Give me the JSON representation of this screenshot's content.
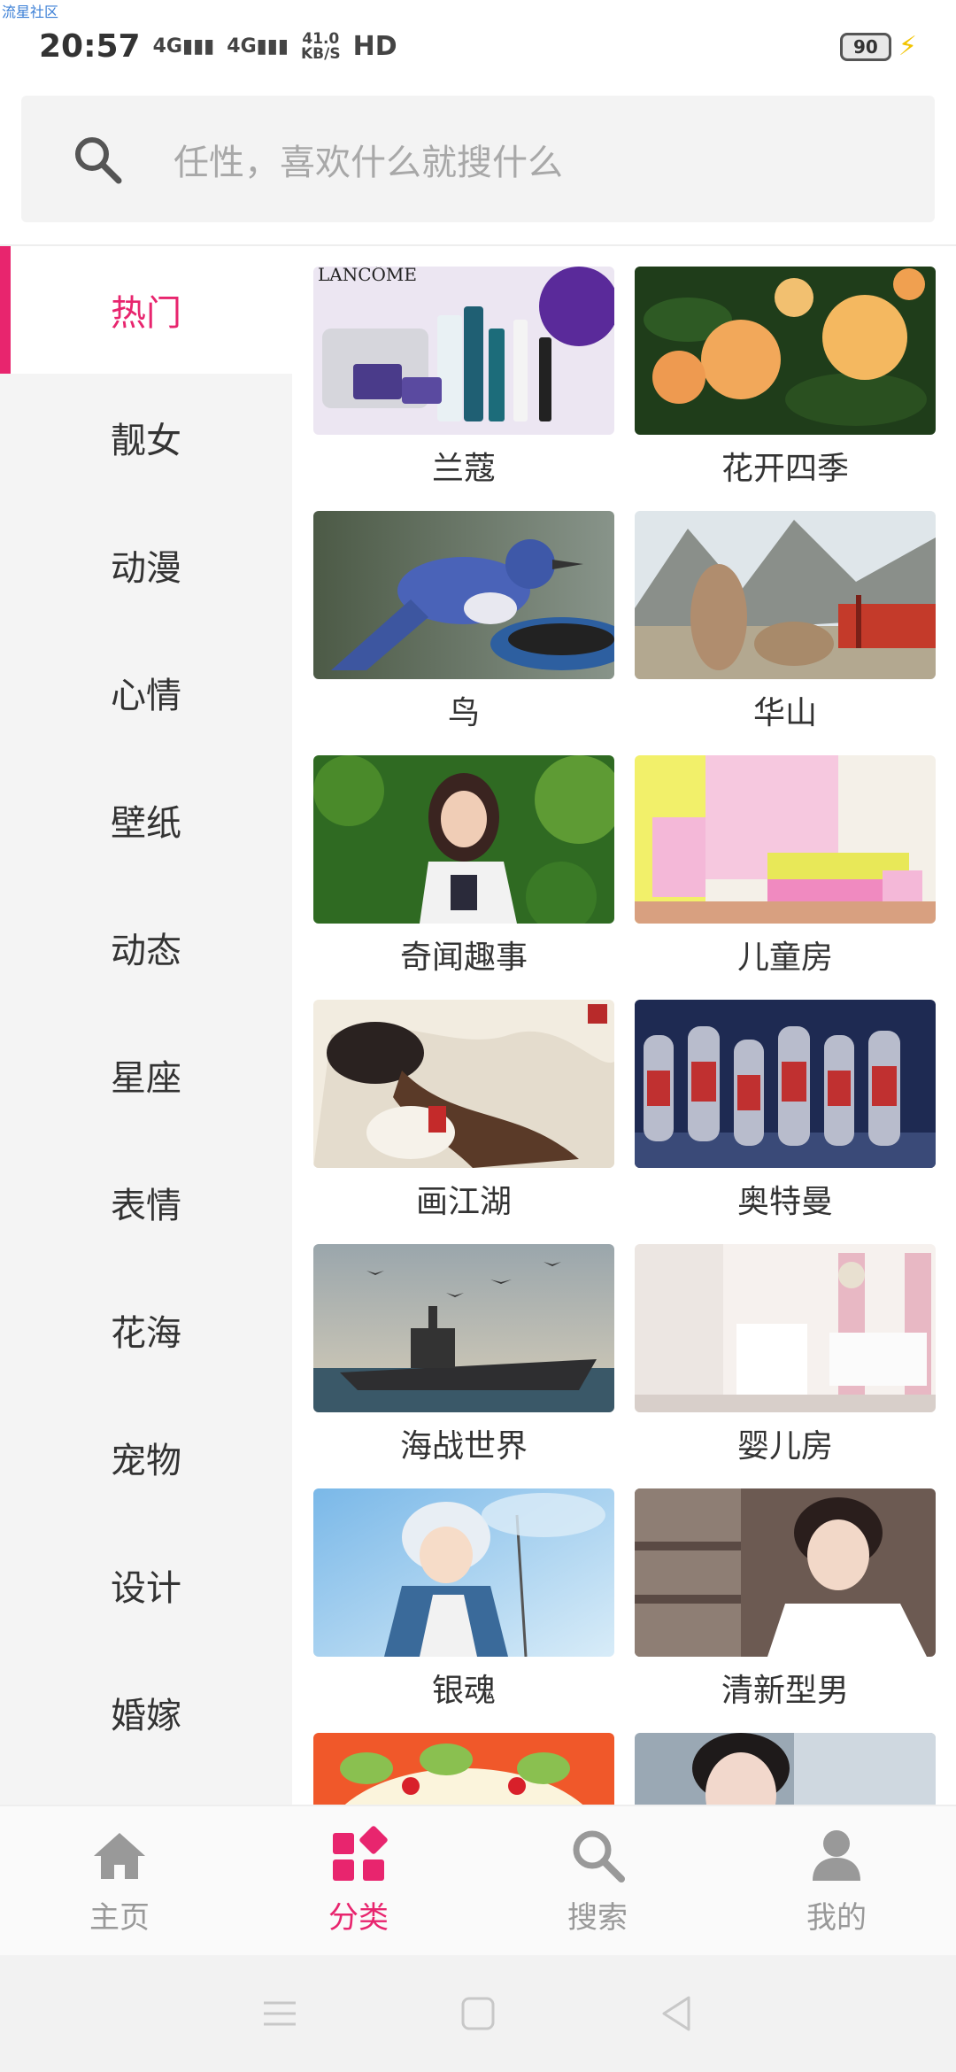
{
  "watermark": "流星社区",
  "status": {
    "time": "20:57",
    "signal1": "4G",
    "signal2": "4G",
    "net_speed_value": "41.0",
    "net_speed_unit": "KB/S",
    "hd": "HD",
    "battery": "90"
  },
  "search": {
    "placeholder": "任性，喜欢什么就搜什么",
    "icon": "search-icon"
  },
  "sidebar": {
    "items": [
      {
        "label": "热门",
        "active": true
      },
      {
        "label": "靓女"
      },
      {
        "label": "动漫"
      },
      {
        "label": "心情"
      },
      {
        "label": "壁纸"
      },
      {
        "label": "动态"
      },
      {
        "label": "星座"
      },
      {
        "label": "表情"
      },
      {
        "label": "花海"
      },
      {
        "label": "宠物"
      },
      {
        "label": "设计"
      },
      {
        "label": "婚嫁"
      }
    ]
  },
  "categories": [
    {
      "label": "兰蔻"
    },
    {
      "label": "花开四季"
    },
    {
      "label": "鸟"
    },
    {
      "label": "华山"
    },
    {
      "label": "奇闻趣事"
    },
    {
      "label": "儿童房"
    },
    {
      "label": "画江湖"
    },
    {
      "label": "奥特曼"
    },
    {
      "label": "海战世界"
    },
    {
      "label": "婴儿房"
    },
    {
      "label": "银魂"
    },
    {
      "label": "清新型男"
    },
    {
      "label": ""
    },
    {
      "label": ""
    }
  ],
  "thumb_text": {
    "lancome": "LANCÔME"
  },
  "bottom_nav": {
    "items": [
      {
        "label": "主页",
        "icon": "home-icon"
      },
      {
        "label": "分类",
        "icon": "category-icon",
        "active": true
      },
      {
        "label": "搜索",
        "icon": "search-icon"
      },
      {
        "label": "我的",
        "icon": "profile-icon"
      }
    ]
  },
  "colors": {
    "accent": "#e8256e",
    "inactive": "#999999"
  }
}
